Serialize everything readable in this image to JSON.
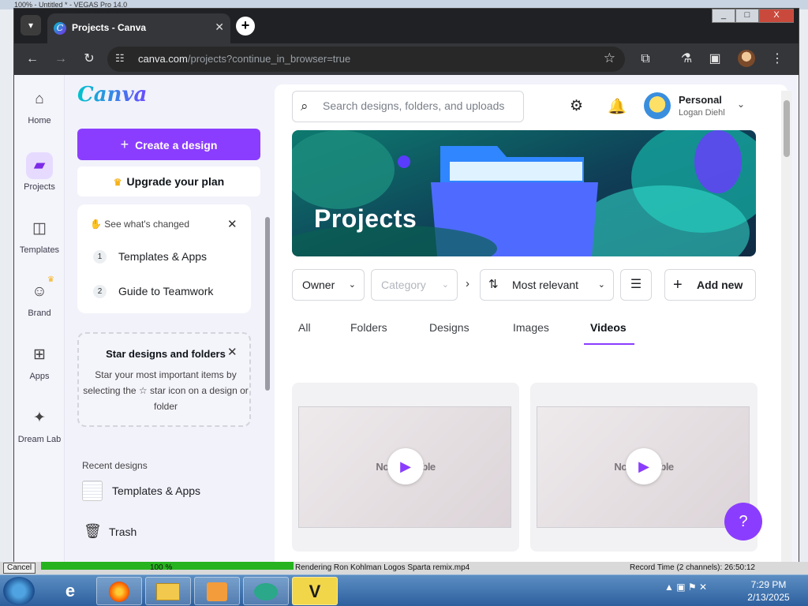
{
  "background": {
    "window_title": "100% - Untitled * - VEGAS Pro 14.0",
    "cancel_label": "Cancel",
    "progress_text": "100 %",
    "render_status": "Rendering Ron Kohlman Logos Sparta remix.mp4",
    "record_time": "Record Time (2 channels): 26:50:12"
  },
  "browser": {
    "tab_title": "Projects - Canva",
    "url_domain": "canva.com",
    "url_path": "/projects?continue_in_browser=true",
    "window_buttons": [
      "_",
      "□",
      "X"
    ]
  },
  "rail": {
    "items": [
      {
        "label": "Home",
        "icon": "home-icon"
      },
      {
        "label": "Projects",
        "icon": "folder-icon"
      },
      {
        "label": "Templates",
        "icon": "templates-icon"
      },
      {
        "label": "Brand",
        "icon": "brand-icon"
      },
      {
        "label": "Apps",
        "icon": "apps-icon"
      },
      {
        "label": "Dream Lab",
        "icon": "dream-lab-icon"
      }
    ]
  },
  "sidepanel": {
    "logo": "Canva",
    "create_label": "Create a design",
    "upgrade_label": "Upgrade your plan",
    "changes_title": "See what's changed",
    "changes": [
      {
        "num": "1",
        "label": "Templates & Apps"
      },
      {
        "num": "2",
        "label": "Guide to Teamwork"
      }
    ],
    "star_title": "Star designs and folders",
    "star_body": "Star your most important items by selecting the ☆ star icon on a design or folder",
    "recent_label": "Recent designs",
    "recent_item": "Templates & Apps",
    "trash_label": "Trash"
  },
  "header": {
    "search_placeholder": "Search designs, folders, and uploads",
    "account_name": "Personal",
    "account_user": "Logan Diehl"
  },
  "banner": {
    "title": "Projects"
  },
  "filters": {
    "owner": "Owner",
    "category": "Category",
    "sort": "Most relevant",
    "add_new": "Add new"
  },
  "tabs": [
    "All",
    "Folders",
    "Designs",
    "Images",
    "Videos"
  ],
  "active_tab": "Videos",
  "videos": [
    {
      "thumb_text": "Now ... ssible"
    },
    {
      "thumb_text": "Now ... ssible"
    }
  ],
  "help_label": "?",
  "taskbar": {
    "time": "7:29 PM",
    "date": "2/13/2025"
  },
  "colors": {
    "accent": "#8b3dff",
    "browser_dark": "#202124"
  }
}
